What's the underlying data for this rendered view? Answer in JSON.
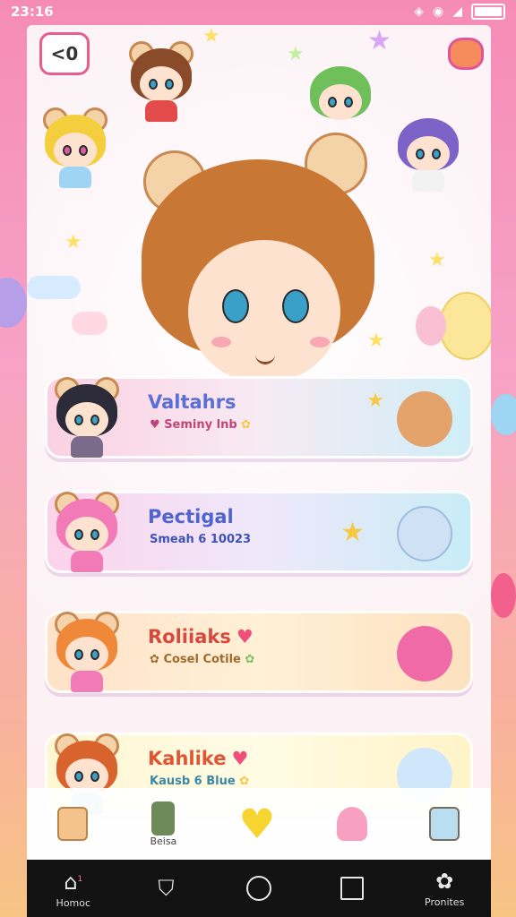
{
  "status_bar": {
    "time": "23:16"
  },
  "header": {
    "back_label": "<0"
  },
  "cards": [
    {
      "title": "Valtahrs",
      "subtitle": "Seminy lnb",
      "has_heart": false
    },
    {
      "title": "Pectigal",
      "subtitle": "Smeah 6 10023",
      "has_heart": false
    },
    {
      "title": "Roliiaks",
      "subtitle": "Cosel Cotile",
      "has_heart": true
    },
    {
      "title": "Kahlike",
      "subtitle": "Kausb 6 Blue",
      "has_heart": true
    }
  ],
  "toolbar": {
    "item2_label": "Beisa"
  },
  "nav": {
    "home_label": "Homoc",
    "home_badge": "1",
    "profile_label": "Pronites"
  },
  "colors": {
    "accent": "#e85d8a",
    "nav_bg": "#121212"
  },
  "icons": [
    "back-arrow-icon",
    "bookmark-icon",
    "home-circle-icon",
    "recent-square-icon",
    "flower-icon",
    "heart-icon",
    "star-icon"
  ]
}
